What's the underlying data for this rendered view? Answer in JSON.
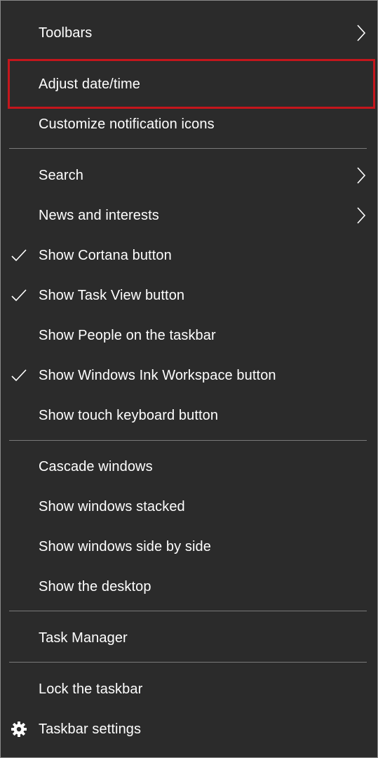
{
  "menu": {
    "items": {
      "toolbars": "Toolbars",
      "adjust_date_time": "Adjust date/time",
      "customize_notification_icons": "Customize notification icons",
      "search": "Search",
      "news_and_interests": "News and interests",
      "show_cortana_button": "Show Cortana button",
      "show_task_view_button": "Show Task View button",
      "show_people": "Show People on the taskbar",
      "show_windows_ink": "Show Windows Ink Workspace button",
      "show_touch_keyboard": "Show touch keyboard button",
      "cascade_windows": "Cascade windows",
      "show_windows_stacked": "Show windows stacked",
      "show_windows_side_by_side": "Show windows side by side",
      "show_desktop": "Show the desktop",
      "task_manager": "Task Manager",
      "lock_taskbar": "Lock the taskbar",
      "taskbar_settings": "Taskbar settings"
    },
    "checked": [
      "show_cortana_button",
      "show_task_view_button",
      "show_windows_ink"
    ],
    "submenus": [
      "toolbars",
      "search",
      "news_and_interests"
    ],
    "highlighted_item": "adjust_date_time"
  },
  "colors": {
    "background": "#2b2b2b",
    "text": "#ffffff",
    "separator": "#7a7a7a",
    "highlight_border": "#c4161c"
  }
}
